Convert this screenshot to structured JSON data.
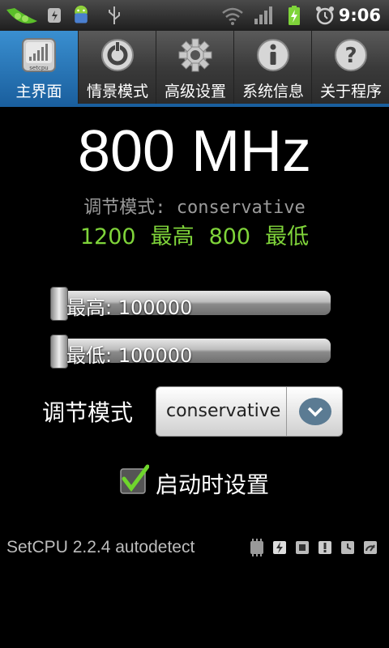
{
  "status_bar": {
    "time": "9:06",
    "icons": [
      "pea-pod-icon",
      "setcpu-notify-icon",
      "android-icon",
      "usb-icon",
      "wifi-icon",
      "signal-icon",
      "battery-charging-icon",
      "alarm-icon"
    ]
  },
  "tabs": [
    {
      "label": "主界面",
      "icon": "setcpu-icon",
      "active": true
    },
    {
      "label": "情景模式",
      "icon": "profile-dial-icon",
      "active": false
    },
    {
      "label": "高级设置",
      "icon": "gear-icon",
      "active": false
    },
    {
      "label": "系统信息",
      "icon": "info-icon",
      "active": false
    },
    {
      "label": "关于程序",
      "icon": "help-icon",
      "active": false
    }
  ],
  "main": {
    "current_freq": "800 MHz",
    "governor_line": "调节模式: conservative",
    "limits": {
      "max_value": "1200",
      "max_label": "最高",
      "min_value": "800",
      "min_label": "最低"
    },
    "max_slider": {
      "label": "最高: 100000",
      "level": 0
    },
    "min_slider": {
      "label": "最低: 100000",
      "level": 0
    },
    "governor_label": "调节模式",
    "governor_value": "conservative",
    "set_on_boot_label": "启动时设置",
    "set_on_boot_checked": true
  },
  "footer": {
    "version_text": "SetCPU 2.2.4 autodetect",
    "chip_icons": [
      "chip-icon",
      "chip-flash-icon",
      "chip-icon",
      "chip-alert-icon",
      "chip-clock-icon",
      "chip-gauge-icon"
    ]
  },
  "colors": {
    "accent": "#1a5f9e",
    "limits_green": "#7fd43a"
  }
}
